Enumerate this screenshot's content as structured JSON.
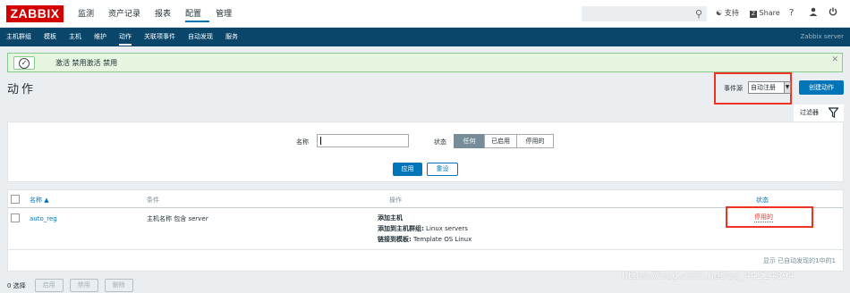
{
  "app": {
    "logo": "ZABBIX"
  },
  "main_nav": [
    "监测",
    "资产记录",
    "报表",
    "配置",
    "管理"
  ],
  "main_nav_active": "配置",
  "top_right": {
    "support": "支持",
    "share": "Share",
    "help": "?",
    "user": "user",
    "logout": "power"
  },
  "sub_nav": [
    "主机群组",
    "模板",
    "主机",
    "维护",
    "动作",
    "关联项事件",
    "自动发现",
    "服务"
  ],
  "sub_nav_active": "动作",
  "server_name": "Zabbix server",
  "message": {
    "text": "激活 禁用激活 禁用"
  },
  "page": {
    "title": "动作",
    "event_source_label": "事件源",
    "event_source_value": "自动注册",
    "create_button": "创建动作"
  },
  "filter": {
    "tab_label": "过滤器",
    "name_label": "名称",
    "name_value": "",
    "status_label": "状态",
    "status_options": [
      "任何",
      "已启用",
      "停用的"
    ],
    "status_selected": "任何",
    "apply": "应用",
    "reset": "重设"
  },
  "table": {
    "columns": {
      "name": "名称 ▲",
      "conditions": "条件",
      "operations": "操作",
      "status": "状态"
    },
    "rows": [
      {
        "name": "auto_reg",
        "condition_prefix": "主机名称 包含 ",
        "condition_value": "server",
        "op1_label": "添加主机",
        "op2_label": "添加到主机群组:",
        "op2_value": " Linux servers",
        "op3_label": "链接到模板:",
        "op3_value": " Template OS Linux",
        "status": "停用的"
      }
    ],
    "pagination": "显示 已自动发现的1中的1"
  },
  "bottom": {
    "selected": "0 选择",
    "enable": "启用",
    "disable": "禁用",
    "delete": "删除"
  },
  "watermark": "https://blog.csdn.net/qq_44224894"
}
